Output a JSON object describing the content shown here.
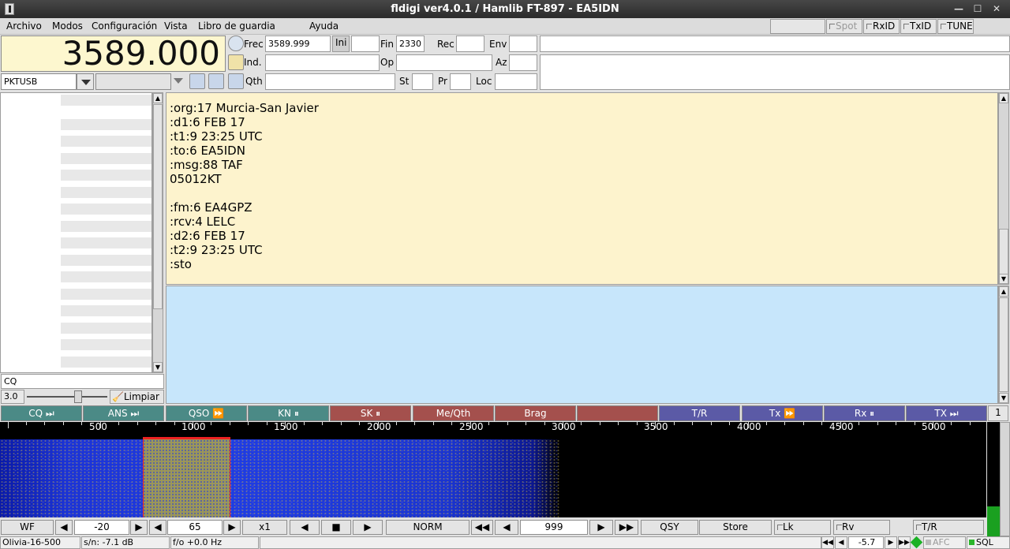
{
  "window": {
    "title": "fldigi ver4.0.1 / Hamlib FT-897 - EA5IDN"
  },
  "menu": {
    "items": [
      "Archivo",
      "Modos",
      "Configuración",
      "Vista",
      "Libro de guardia",
      "Ayuda"
    ]
  },
  "toggles": {
    "spot": "Spot",
    "rxid": "RxID",
    "txid": "TxID",
    "tune": "TUNE"
  },
  "rig": {
    "frequency": "3589.000",
    "mode": "PKTUSB"
  },
  "log": {
    "frec_label": "Frec",
    "frec_value": "3589.999",
    "ini_label": "Ini",
    "ini_value": "",
    "fin_label": "Fin",
    "fin_value": "2330",
    "rec_label": "Rec",
    "rec_value": "",
    "env_label": "Env",
    "env_value": "",
    "ind_label": "Ind.",
    "ind_value": "",
    "op_label": "Op",
    "op_value": "",
    "az_label": "Az",
    "az_value": "",
    "qth_label": "Qth",
    "qth_value": "",
    "st_label": "St",
    "st_value": "",
    "pr_label": "Pr",
    "pr_value": "",
    "loc_label": "Loc",
    "loc_value": ""
  },
  "rx_text": ":org:17 Murcia-San Javier\n:d1:6 FEB 17\n:t1:9 23:25 UTC\n:to:6 EA5IDN\n:msg:88 TAF\n05012KT\n\n:fm:6 EA4GPZ\n:rcv:4 LELC\n:d2:6 FEB 17\n:t2:9 23:25 UTC\n:sto",
  "left_panel": {
    "search_value": "CQ",
    "squelch_value": "3.0",
    "clear_label": "Limpiar"
  },
  "macros": [
    {
      "label": "CQ ⏭",
      "color": "#4b8a86"
    },
    {
      "label": "ANS ⏭",
      "color": "#4b8a86"
    },
    {
      "label": "QSO ⏩",
      "color": "#4b8a86"
    },
    {
      "label": "KN ⏸",
      "color": "#4b8a86"
    },
    {
      "label": "SK ⏸",
      "color": "#a4504d"
    },
    {
      "label": "Me/Qth",
      "color": "#a4504d"
    },
    {
      "label": "Brag",
      "color": "#a4504d"
    },
    {
      "label": "",
      "color": "#a4504d"
    },
    {
      "label": "T/R",
      "color": "#5b5aa6"
    },
    {
      "label": "Tx ⏩",
      "color": "#5b5aa6"
    },
    {
      "label": "Rx ⏸",
      "color": "#5b5aa6"
    },
    {
      "label": "TX ⏭",
      "color": "#5b5aa6"
    }
  ],
  "macro_bank": "1",
  "ruler": {
    "labels": [
      "500",
      "1000",
      "1500",
      "2000",
      "2500",
      "3000",
      "3500",
      "4000",
      "4500",
      "5000"
    ]
  },
  "controls": {
    "wf_label": "WF",
    "ref_value": "-20",
    "range_value": "65",
    "zoom_label": "x1",
    "norm_label": "NORM",
    "carrier_value": "999",
    "qsy_label": "QSY",
    "store_label": "Store",
    "lk_label": "Lk",
    "rv_label": "Rv",
    "tr_label": "T/R"
  },
  "statusbar": {
    "mode": "Olivia-16-500",
    "snr": "s/n: -7.1 dB",
    "fo": "f/o +0.0 Hz",
    "atten_value": "-5.7",
    "afc_label": "AFC",
    "sql_label": "SQL"
  }
}
